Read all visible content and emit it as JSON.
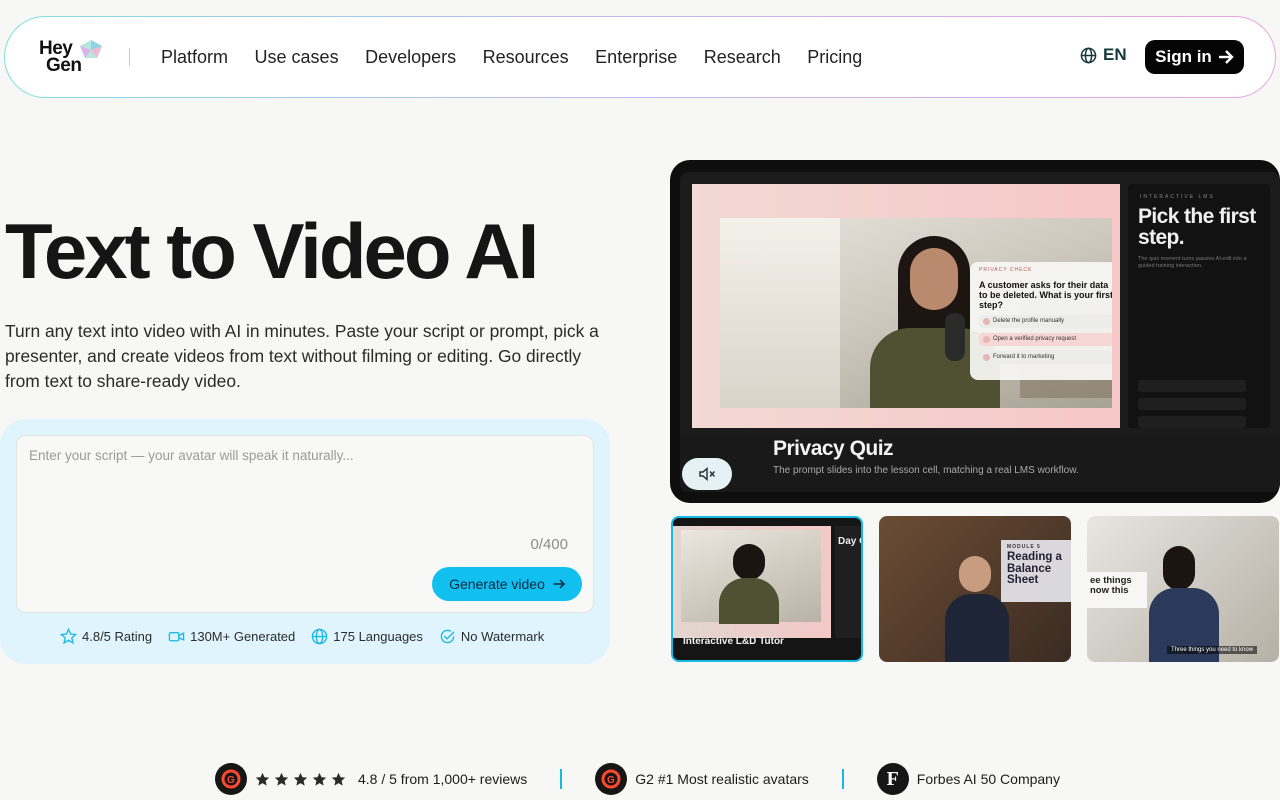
{
  "logo": {
    "line1": "Hey",
    "line2": "Gen"
  },
  "nav": {
    "links": [
      "Platform",
      "Use cases",
      "Developers",
      "Resources",
      "Enterprise",
      "Research",
      "Pricing"
    ],
    "language": "EN",
    "signin_label": "Sign in"
  },
  "hero": {
    "title": "Text to Video AI",
    "subtitle": "Turn any text into video with AI in minutes. Paste your script or prompt, pick a presenter, and create videos from text without filming or editing. Go directly from text to share-ready video."
  },
  "script": {
    "placeholder": "Enter your script — your avatar will speak it naturally...",
    "value": "",
    "counter": "0/400",
    "generate_label": "Generate video"
  },
  "badges": [
    {
      "icon": "star-icon",
      "label": "4.8/5 Rating"
    },
    {
      "icon": "video-camera-icon",
      "label": "130M+ Generated"
    },
    {
      "icon": "globe-icon",
      "label": "175 Languages"
    },
    {
      "icon": "check-circle-icon",
      "label": "No Watermark"
    }
  ],
  "video": {
    "title": "Privacy Quiz",
    "subtitle": "The prompt slides into the lesson cell, matching a real LMS workflow.",
    "quiz": {
      "kicker": "PRIVACY CHECK",
      "question": "A customer asks for their data to be deleted. What is your first step?",
      "options": [
        "Delete the profile manually",
        "Open a verified privacy request",
        "Forward it to marketing"
      ]
    },
    "side_panel": {
      "kicker": "INTERACTIVE LMS",
      "heading": "Pick the first step.",
      "text": "The quiz moment turns passive AI-edit into a guided training interaction."
    }
  },
  "thumbnails": [
    {
      "label": "Interactive L&D Tutor",
      "side_text": "Day O"
    },
    {
      "card_kicker": "MODULE 5",
      "card_title": "Reading a Balance Sheet"
    },
    {
      "card_text": "ee things now this",
      "caption": "Three things you need to know"
    }
  ],
  "proof": [
    {
      "icon": "g2-icon",
      "text": "4.8 / 5 from 1,000+ reviews",
      "stars": 5
    },
    {
      "icon": "g2-icon",
      "text": "G2 #1 Most realistic avatars"
    },
    {
      "icon": "forbes-icon",
      "icon_letter": "F",
      "text": "Forbes AI 50 Company"
    }
  ],
  "colors": {
    "accent": "#11c0ef",
    "nav_button": "#050505",
    "g2_red": "#ff492c",
    "script_bg": "#dff4fd"
  }
}
